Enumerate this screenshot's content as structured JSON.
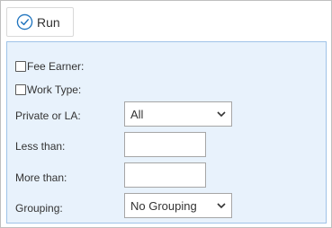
{
  "toolbar": {
    "run_label": "Run",
    "run_icon": "check-circle-icon",
    "accent": "#1e73be"
  },
  "filters": {
    "fee_earner": {
      "label": "Fee Earner:",
      "checked": false
    },
    "work_type": {
      "label": "Work Type:",
      "checked": false
    },
    "private_or_la": {
      "label": "Private or LA:",
      "value": "All"
    },
    "less_than": {
      "label": "Less than:",
      "value": ""
    },
    "more_than": {
      "label": "More than:",
      "value": ""
    },
    "grouping": {
      "label": "Grouping:",
      "value": "No Grouping"
    }
  },
  "colors": {
    "panel_background": "#e8f2fc",
    "panel_border": "#9fc3e8"
  }
}
